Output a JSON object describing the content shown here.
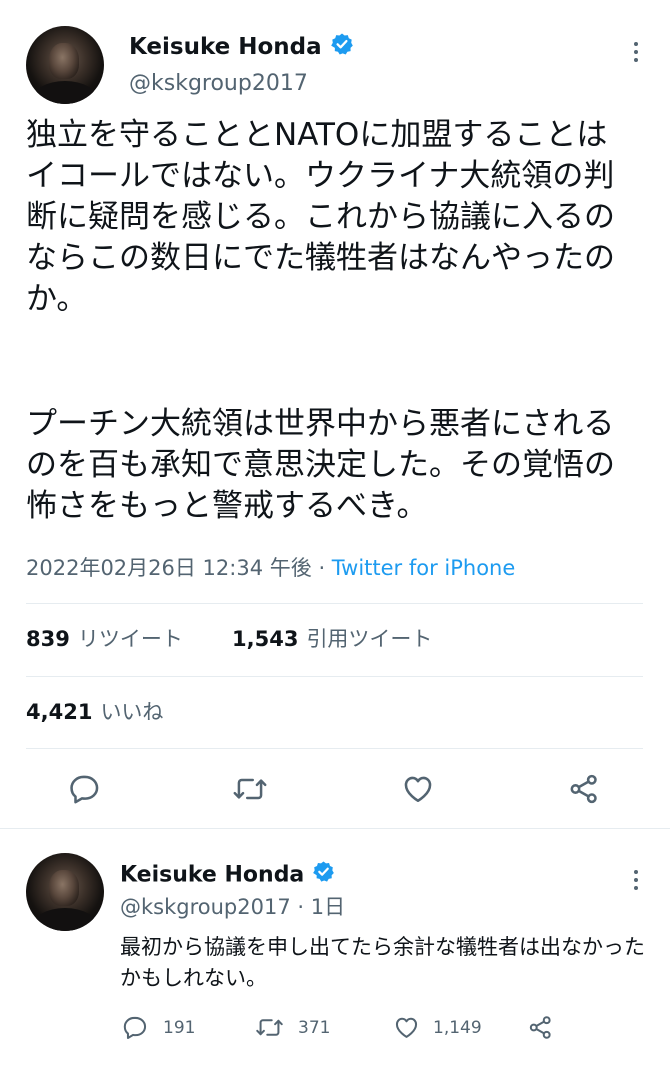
{
  "main_tweet": {
    "author_name": "Keisuke Honda",
    "author_handle": "@kskgroup2017",
    "paragraph1": "独立を守ることとNATOに加盟することはイコールではない。ウクライナ大統領の判断に疑問を感じる。これから協議に入るのならこの数日にでた犠牲者はなんやったのか。",
    "paragraph2": "プーチン大統領は世界中から悪者にされるのを百も承知で意思決定した。その覚悟の怖さをもっと警戒するべき。",
    "timestamp": "2022年02月26日 12:34 午後",
    "separator": " · ",
    "source": "Twitter for iPhone",
    "stats": {
      "retweets_count": "839",
      "retweets_label": "リツイート",
      "quotes_count": "1,543",
      "quotes_label": "引用ツイート",
      "likes_count": "4,421",
      "likes_label": "いいね"
    },
    "actions": [
      "reply-icon",
      "retweet-icon",
      "like-icon",
      "share-icon"
    ]
  },
  "reply_tweet": {
    "author_name": "Keisuke Honda",
    "author_handle": "@kskgroup2017",
    "age": "· 1日",
    "text": "最初から協議を申し出てたら余計な犠牲者は出なかったかもしれない。",
    "counts": {
      "replies": "191",
      "retweets": "371",
      "likes": "1,149"
    }
  },
  "colors": {
    "text": "#0f1419",
    "secondary": "#536471",
    "link": "#1d9bf0",
    "verified": "#1d9bf0",
    "divider": "#e6ecf0"
  }
}
